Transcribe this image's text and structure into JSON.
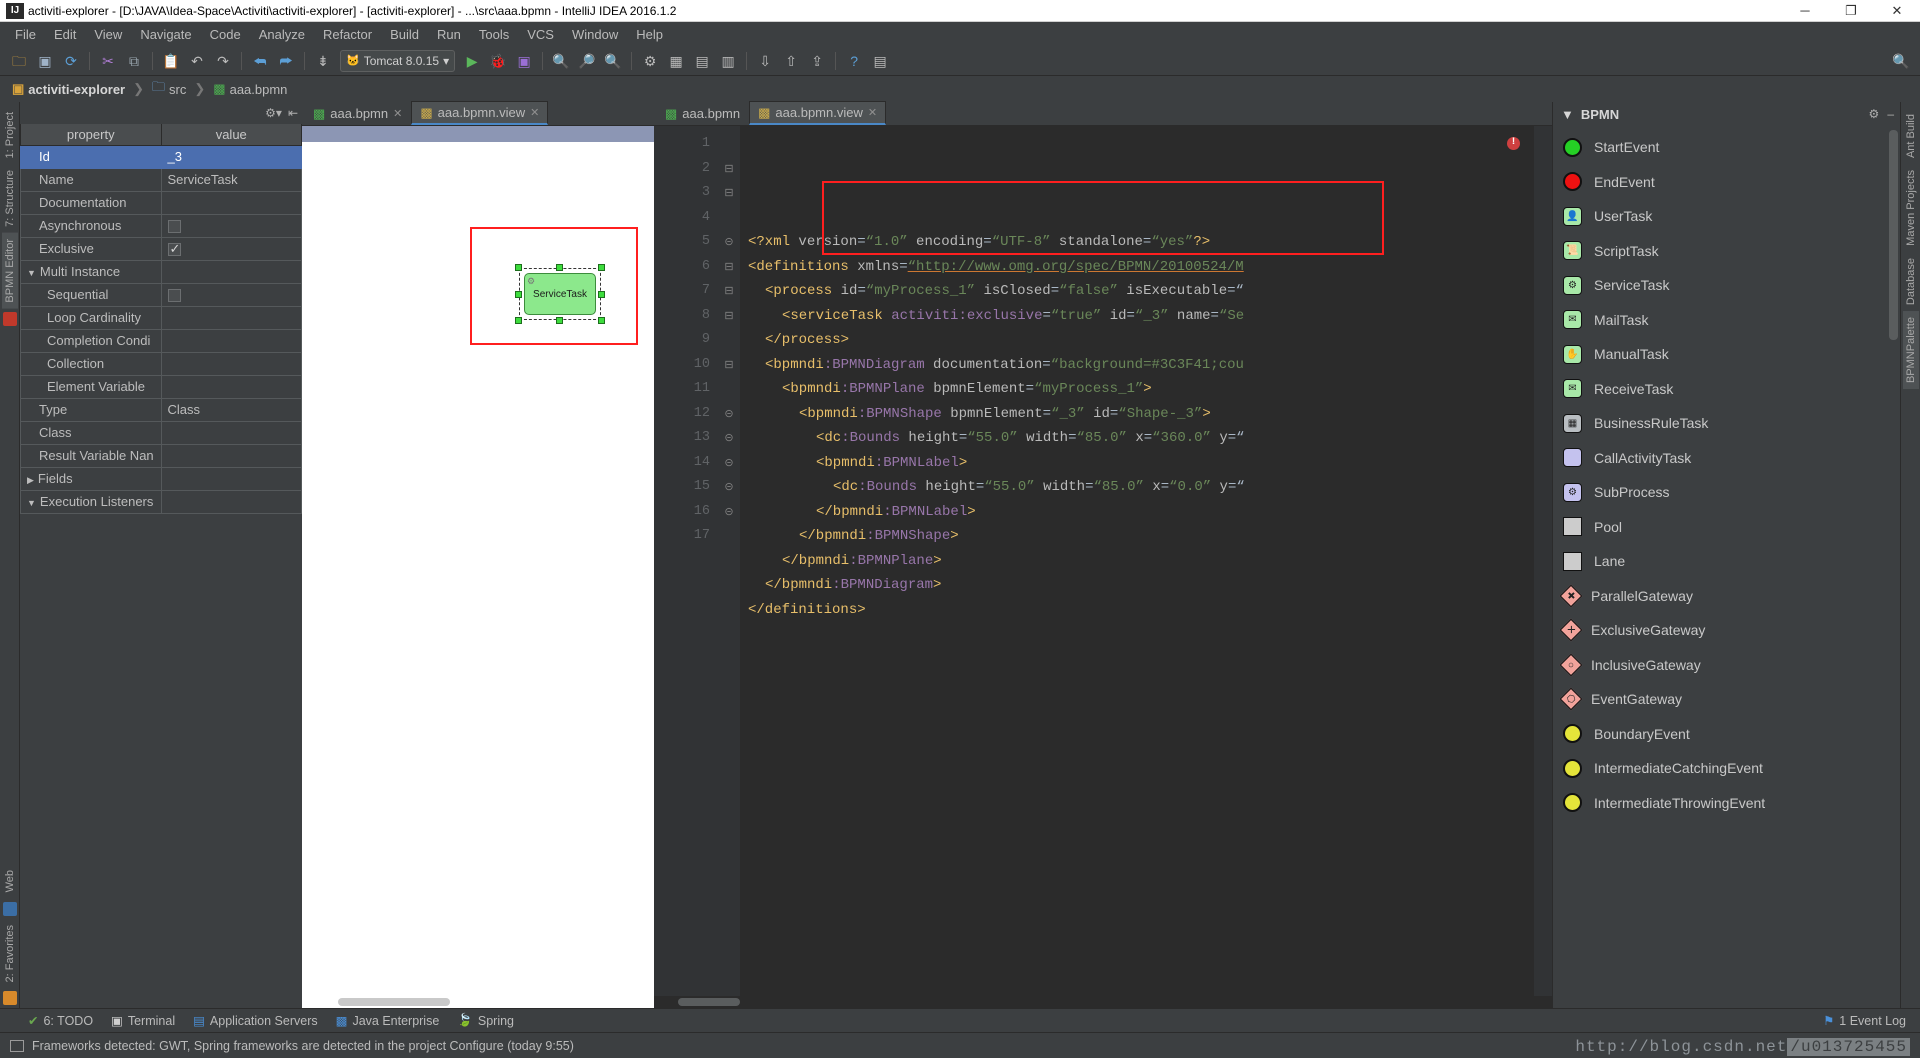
{
  "window": {
    "title": "activiti-explorer - [D:\\JAVA\\Idea-Space\\Activiti\\activiti-explorer] - [activiti-explorer] - ...\\src\\aaa.bpmn - IntelliJ IDEA 2016.1.2",
    "app_icon": "IJ",
    "minimize": "─",
    "maximize": "❐",
    "close": "✕"
  },
  "menu": {
    "items": [
      "File",
      "Edit",
      "View",
      "Navigate",
      "Code",
      "Analyze",
      "Refactor",
      "Build",
      "Run",
      "Tools",
      "VCS",
      "Window",
      "Help"
    ]
  },
  "toolbar": {
    "run_config": "Tomcat 8.0.15",
    "run_config_caret": "▾",
    "icons": [
      "open-folder-icon",
      "save-all-icon",
      "sync-icon",
      "cut-icon",
      "copy-icon",
      "paste-icon",
      "undo-icon",
      "redo-icon",
      "compile-icon",
      "rerun-icon",
      "back-icon",
      "forward-icon",
      "search-everywhere-icon"
    ],
    "run_button": "▶",
    "debug_button": "🐞",
    "coverage_button": "▣",
    "help_button": "?",
    "search_button": "🔍"
  },
  "breadcrumb": {
    "items": [
      {
        "label": "activiti-explorer",
        "icon": "module-icon"
      },
      {
        "label": "src",
        "icon": "folder-icon"
      },
      {
        "label": "aaa.bpmn",
        "icon": "bpmn-file-icon"
      }
    ],
    "separator": "❯"
  },
  "left_strip": {
    "tabs": [
      "1: Project",
      "7: Structure",
      "BPMN Editor"
    ],
    "bottom_tabs": [
      "2: Favorites",
      "Web"
    ]
  },
  "right_strip": {
    "tabs": [
      "Ant Build",
      "Maven Projects",
      "Database",
      "BPMNPalette"
    ]
  },
  "properties": {
    "header_property": "property",
    "header_value": "value",
    "rows": [
      {
        "name": "Id",
        "value": "_3",
        "selected": true,
        "indent": 0,
        "type": "text"
      },
      {
        "name": "Name",
        "value": "ServiceTask",
        "selected": false,
        "indent": 0,
        "type": "text"
      },
      {
        "name": "Documentation",
        "value": "",
        "selected": false,
        "indent": 0,
        "type": "text"
      },
      {
        "name": "Asynchronous",
        "value": "",
        "selected": false,
        "indent": 0,
        "type": "checkbox",
        "checked": false
      },
      {
        "name": "Exclusive",
        "value": "",
        "selected": false,
        "indent": 0,
        "type": "checkbox",
        "checked": true
      },
      {
        "name": "Multi Instance",
        "value": "",
        "selected": false,
        "indent": 0,
        "type": "group",
        "expander": "▼"
      },
      {
        "name": "Sequential",
        "value": "",
        "selected": false,
        "indent": 1,
        "type": "checkbox",
        "checked": false
      },
      {
        "name": "Loop Cardinality",
        "value": "",
        "selected": false,
        "indent": 1,
        "type": "text"
      },
      {
        "name": "Completion Condi",
        "value": "",
        "selected": false,
        "indent": 1,
        "type": "text"
      },
      {
        "name": "Collection",
        "value": "",
        "selected": false,
        "indent": 1,
        "type": "text"
      },
      {
        "name": "Element Variable",
        "value": "",
        "selected": false,
        "indent": 1,
        "type": "text"
      },
      {
        "name": "Type",
        "value": "Class",
        "selected": false,
        "indent": 0,
        "type": "text"
      },
      {
        "name": "Class",
        "value": "",
        "selected": false,
        "indent": 0,
        "type": "text"
      },
      {
        "name": "Result Variable Nan",
        "value": "",
        "selected": false,
        "indent": 0,
        "type": "text"
      },
      {
        "name": "Fields",
        "value": "",
        "selected": false,
        "indent": 0,
        "type": "group",
        "expander": "▶"
      },
      {
        "name": "Execution Listeners",
        "value": "",
        "selected": false,
        "indent": 0,
        "type": "group",
        "expander": "▼"
      }
    ]
  },
  "diagram_editor": {
    "tabs": [
      {
        "label": "aaa.bpmn",
        "active": false,
        "close": "✕",
        "icon": "bpmn-file-icon"
      },
      {
        "label": "aaa.bpmn.view",
        "active": true,
        "close": "✕",
        "icon": "view-file-icon"
      }
    ],
    "node_label": "ServiceTask"
  },
  "code_editor": {
    "tabs": [
      {
        "label": "aaa.bpmn",
        "active": false,
        "close": "",
        "icon": "bpmn-file-icon"
      },
      {
        "label": "aaa.bpmn.view",
        "active": true,
        "close": "✕",
        "icon": "view-file-icon"
      }
    ],
    "error_badge": "!",
    "lines": [
      {
        "n": 1,
        "fold": "",
        "indent": 0,
        "tokens": [
          {
            "t": "<?xml ",
            "c": "tok-pi"
          },
          {
            "t": "version",
            "c": "tok-attr"
          },
          {
            "t": "=",
            "c": "tok-plain"
          },
          {
            "t": "“1.0”",
            "c": "tok-val"
          },
          {
            "t": " encoding",
            "c": "tok-attr"
          },
          {
            "t": "=",
            "c": "tok-plain"
          },
          {
            "t": "“UTF-8”",
            "c": "tok-val"
          },
          {
            "t": " standalone",
            "c": "tok-attr"
          },
          {
            "t": "=",
            "c": "tok-plain"
          },
          {
            "t": "“yes”",
            "c": "tok-val"
          },
          {
            "t": "?>",
            "c": "tok-pi"
          }
        ]
      },
      {
        "n": 2,
        "fold": "⊟",
        "indent": 0,
        "tokens": [
          {
            "t": "<definitions",
            "c": "tok-tag"
          },
          {
            "t": " xmlns",
            "c": "tok-attr"
          },
          {
            "t": "=",
            "c": "tok-plain"
          },
          {
            "t": "“http://www.omg.org/spec/BPMN/20100524/M",
            "c": "tok-link"
          }
        ]
      },
      {
        "n": 3,
        "fold": "⊟",
        "indent": 1,
        "tokens": [
          {
            "t": "<process",
            "c": "tok-tag"
          },
          {
            "t": " id",
            "c": "tok-attr"
          },
          {
            "t": "=",
            "c": "tok-plain"
          },
          {
            "t": "“myProcess_1”",
            "c": "tok-val"
          },
          {
            "t": " isClosed",
            "c": "tok-attr"
          },
          {
            "t": "=",
            "c": "tok-plain"
          },
          {
            "t": "“false”",
            "c": "tok-val"
          },
          {
            "t": " isExecutable",
            "c": "tok-attr"
          },
          {
            "t": "=“",
            "c": "tok-plain"
          }
        ]
      },
      {
        "n": 4,
        "fold": "",
        "indent": 2,
        "tokens": [
          {
            "t": "<serviceTask",
            "c": "tok-tag"
          },
          {
            "t": " activiti",
            "c": "tok-ns"
          },
          {
            "t": ":exclusive",
            "c": "tok-ns"
          },
          {
            "t": "=",
            "c": "tok-plain"
          },
          {
            "t": "“true”",
            "c": "tok-val"
          },
          {
            "t": " id",
            "c": "tok-attr"
          },
          {
            "t": "=",
            "c": "tok-plain"
          },
          {
            "t": "“_3”",
            "c": "tok-val"
          },
          {
            "t": " name",
            "c": "tok-attr"
          },
          {
            "t": "=",
            "c": "tok-plain"
          },
          {
            "t": "“Se",
            "c": "tok-val"
          }
        ]
      },
      {
        "n": 5,
        "fold": "⊝",
        "indent": 1,
        "tokens": [
          {
            "t": "</process>",
            "c": "tok-tag"
          }
        ]
      },
      {
        "n": 6,
        "fold": "⊟",
        "indent": 1,
        "tokens": [
          {
            "t": "<bpmndi",
            "c": "tok-tag"
          },
          {
            "t": ":BPMNDiagram",
            "c": "tok-ns"
          },
          {
            "t": " documentation",
            "c": "tok-attr"
          },
          {
            "t": "=",
            "c": "tok-plain"
          },
          {
            "t": "“background=#3C3F41;cou",
            "c": "tok-val"
          }
        ]
      },
      {
        "n": 7,
        "fold": "⊟",
        "indent": 2,
        "tokens": [
          {
            "t": "<bpmndi",
            "c": "tok-tag"
          },
          {
            "t": ":BPMNPlane",
            "c": "tok-ns"
          },
          {
            "t": " bpmnElement",
            "c": "tok-attr"
          },
          {
            "t": "=",
            "c": "tok-plain"
          },
          {
            "t": "“myProcess_1”",
            "c": "tok-val"
          },
          {
            "t": ">",
            "c": "tok-tag"
          }
        ]
      },
      {
        "n": 8,
        "fold": "⊟",
        "indent": 3,
        "tokens": [
          {
            "t": "<bpmndi",
            "c": "tok-tag"
          },
          {
            "t": ":BPMNShape",
            "c": "tok-ns"
          },
          {
            "t": " bpmnElement",
            "c": "tok-attr"
          },
          {
            "t": "=",
            "c": "tok-plain"
          },
          {
            "t": "“_3”",
            "c": "tok-val"
          },
          {
            "t": " id",
            "c": "tok-attr"
          },
          {
            "t": "=",
            "c": "tok-plain"
          },
          {
            "t": "“Shape-_3”",
            "c": "tok-val"
          },
          {
            "t": ">",
            "c": "tok-tag"
          }
        ]
      },
      {
        "n": 9,
        "fold": "",
        "indent": 4,
        "tokens": [
          {
            "t": "<dc",
            "c": "tok-tag"
          },
          {
            "t": ":Bounds",
            "c": "tok-ns"
          },
          {
            "t": " height",
            "c": "tok-attr"
          },
          {
            "t": "=",
            "c": "tok-plain"
          },
          {
            "t": "“55.0”",
            "c": "tok-val"
          },
          {
            "t": " width",
            "c": "tok-attr"
          },
          {
            "t": "=",
            "c": "tok-plain"
          },
          {
            "t": "“85.0”",
            "c": "tok-val"
          },
          {
            "t": " x",
            "c": "tok-attr"
          },
          {
            "t": "=",
            "c": "tok-plain"
          },
          {
            "t": "“360.0”",
            "c": "tok-val"
          },
          {
            "t": " y",
            "c": "tok-attr"
          },
          {
            "t": "=“",
            "c": "tok-plain"
          }
        ]
      },
      {
        "n": 10,
        "fold": "⊟",
        "indent": 4,
        "tokens": [
          {
            "t": "<bpmndi",
            "c": "tok-tag"
          },
          {
            "t": ":BPMNLabel",
            "c": "tok-ns"
          },
          {
            "t": ">",
            "c": "tok-tag"
          }
        ]
      },
      {
        "n": 11,
        "fold": "",
        "indent": 5,
        "tokens": [
          {
            "t": "<dc",
            "c": "tok-tag"
          },
          {
            "t": ":Bounds",
            "c": "tok-ns"
          },
          {
            "t": " height",
            "c": "tok-attr"
          },
          {
            "t": "=",
            "c": "tok-plain"
          },
          {
            "t": "“55.0”",
            "c": "tok-val"
          },
          {
            "t": " width",
            "c": "tok-attr"
          },
          {
            "t": "=",
            "c": "tok-plain"
          },
          {
            "t": "“85.0”",
            "c": "tok-val"
          },
          {
            "t": " x",
            "c": "tok-attr"
          },
          {
            "t": "=",
            "c": "tok-plain"
          },
          {
            "t": "“0.0”",
            "c": "tok-val"
          },
          {
            "t": " y",
            "c": "tok-attr"
          },
          {
            "t": "=“",
            "c": "tok-plain"
          }
        ]
      },
      {
        "n": 12,
        "fold": "⊝",
        "indent": 4,
        "tokens": [
          {
            "t": "</bpmndi",
            "c": "tok-tag"
          },
          {
            "t": ":BPMNLabel",
            "c": "tok-ns"
          },
          {
            "t": ">",
            "c": "tok-tag"
          }
        ]
      },
      {
        "n": 13,
        "fold": "⊝",
        "indent": 3,
        "tokens": [
          {
            "t": "</bpmndi",
            "c": "tok-tag"
          },
          {
            "t": ":BPMNShape",
            "c": "tok-ns"
          },
          {
            "t": ">",
            "c": "tok-tag"
          }
        ]
      },
      {
        "n": 14,
        "fold": "⊝",
        "indent": 2,
        "tokens": [
          {
            "t": "</bpmndi",
            "c": "tok-tag"
          },
          {
            "t": ":BPMNPlane",
            "c": "tok-ns"
          },
          {
            "t": ">",
            "c": "tok-tag"
          }
        ]
      },
      {
        "n": 15,
        "fold": "⊝",
        "indent": 1,
        "tokens": [
          {
            "t": "</bpmndi",
            "c": "tok-tag"
          },
          {
            "t": ":BPMNDiagram",
            "c": "tok-ns"
          },
          {
            "t": ">",
            "c": "tok-tag"
          }
        ]
      },
      {
        "n": 16,
        "fold": "⊝",
        "indent": 0,
        "tokens": [
          {
            "t": "</definitions>",
            "c": "tok-tag"
          }
        ]
      },
      {
        "n": 17,
        "fold": "",
        "indent": 0,
        "tokens": []
      }
    ]
  },
  "palette": {
    "title": "BPMN",
    "expander": "▼",
    "settings_icon": "⚙",
    "collapse_icon": "–",
    "items": [
      {
        "label": "StartEvent",
        "icon": "start-event-icon",
        "shape": "circle",
        "color": "#25d025"
      },
      {
        "label": "EndEvent",
        "icon": "end-event-icon",
        "shape": "circle",
        "color": "#ee1111"
      },
      {
        "label": "UserTask",
        "icon": "user-task-icon",
        "shape": "round",
        "color": "#a8e8a8",
        "glyph": "👤"
      },
      {
        "label": "ScriptTask",
        "icon": "script-task-icon",
        "shape": "round",
        "color": "#a8e8a8",
        "glyph": "📜"
      },
      {
        "label": "ServiceTask",
        "icon": "service-task-icon",
        "shape": "round",
        "color": "#a8e8a8",
        "glyph": "⚙"
      },
      {
        "label": "MailTask",
        "icon": "mail-task-icon",
        "shape": "round",
        "color": "#a8e8a8",
        "glyph": "✉"
      },
      {
        "label": "ManualTask",
        "icon": "manual-task-icon",
        "shape": "round",
        "color": "#a8e8a8",
        "glyph": "✋"
      },
      {
        "label": "ReceiveTask",
        "icon": "receive-task-icon",
        "shape": "round",
        "color": "#a8e8a8",
        "glyph": "✉"
      },
      {
        "label": "BusinessRuleTask",
        "icon": "business-rule-task-icon",
        "shape": "round",
        "color": "#b9bec2",
        "glyph": "▦"
      },
      {
        "label": "CallActivityTask",
        "icon": "call-activity-task-icon",
        "shape": "round",
        "color": "#c4c2ee",
        "glyph": ""
      },
      {
        "label": "SubProcess",
        "icon": "sub-process-icon",
        "shape": "round",
        "color": "#c4c2ee",
        "glyph": "⚙"
      },
      {
        "label": "Pool",
        "icon": "pool-icon",
        "shape": "square",
        "color": "#cccccc",
        "glyph": ""
      },
      {
        "label": "Lane",
        "icon": "lane-icon",
        "shape": "square",
        "color": "#cccccc",
        "glyph": ""
      },
      {
        "label": "ParallelGateway",
        "icon": "parallel-gateway-icon",
        "shape": "diamond",
        "color": "#f2a39b",
        "glyph": "✚"
      },
      {
        "label": "ExclusiveGateway",
        "icon": "exclusive-gateway-icon",
        "shape": "diamond",
        "color": "#f2a39b",
        "glyph": "✕"
      },
      {
        "label": "InclusiveGateway",
        "icon": "inclusive-gateway-icon",
        "shape": "diamond",
        "color": "#f2a39b",
        "glyph": "○"
      },
      {
        "label": "EventGateway",
        "icon": "event-gateway-icon",
        "shape": "diamond",
        "color": "#f2a39b",
        "glyph": "⬡"
      },
      {
        "label": "BoundaryEvent",
        "icon": "boundary-event-icon",
        "shape": "circle",
        "color": "#e4e43a"
      },
      {
        "label": "IntermediateCatchingEvent",
        "icon": "intermediate-catching-event-icon",
        "shape": "circle",
        "color": "#e4e43a"
      },
      {
        "label": "IntermediateThrowingEvent",
        "icon": "intermediate-throwing-event-icon",
        "shape": "circle",
        "color": "#e4e43a"
      }
    ]
  },
  "bottom_bar": {
    "items": [
      {
        "label": "6: TODO",
        "icon": "todo-icon"
      },
      {
        "label": "Terminal",
        "icon": "terminal-icon"
      },
      {
        "label": "Application Servers",
        "icon": "app-servers-icon"
      },
      {
        "label": "Java Enterprise",
        "icon": "java-enterprise-icon"
      },
      {
        "label": "Spring",
        "icon": "spring-icon"
      }
    ],
    "event_log": "1 Event Log",
    "event_log_icon": "⚑"
  },
  "status_bar": {
    "message": "Frameworks detected: GWT, Spring frameworks are detected in the project Configure (today 9:55)"
  },
  "watermark": {
    "text": "http://blog.csdn.net",
    "suffix": "/u013725455"
  },
  "colors": {
    "accent": "#4b6eaf",
    "bg": "#3c3f41",
    "editor_bg": "#2b2b2b",
    "highlight_red": "#ff1f1f",
    "node_green": "#8ce88c"
  }
}
